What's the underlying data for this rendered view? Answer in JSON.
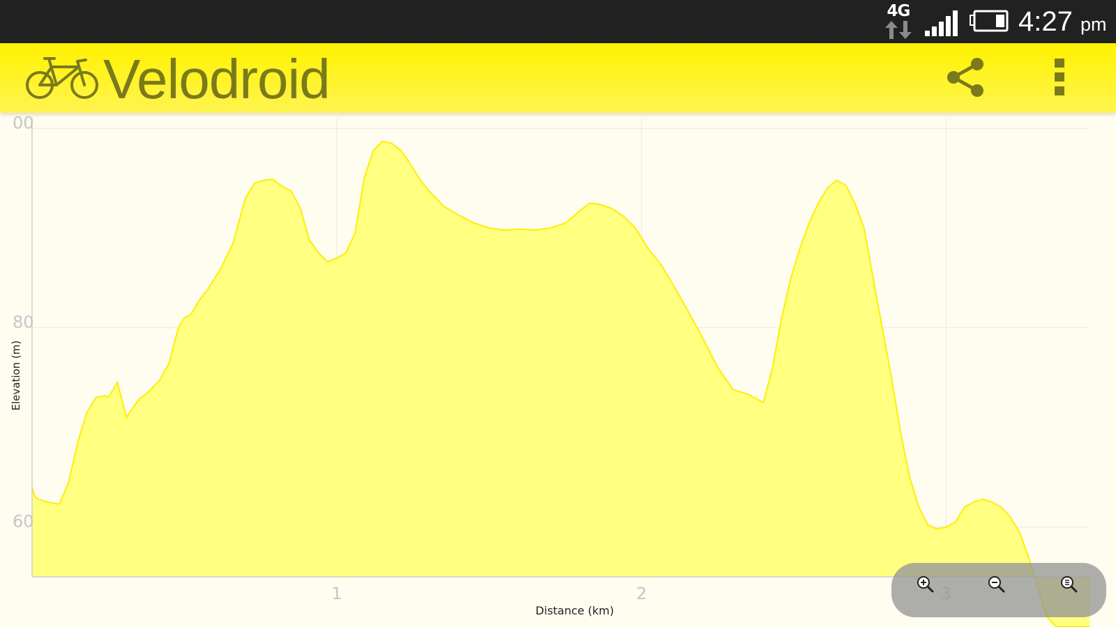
{
  "status_bar": {
    "network_type": "4G",
    "network_arrows_icon": "data-transfer-arrows-icon",
    "signal_icon": "signal-strength-icon",
    "battery_icon": "battery-icon",
    "time": "4:27",
    "ampm": "pm"
  },
  "app_bar": {
    "logo_icon": "bicycle-icon",
    "title": "Velodroid",
    "share_icon": "share-icon",
    "overflow_icon": "overflow-menu-icon",
    "background_color": "#fff200",
    "title_color": "#7a7a1a"
  },
  "zoom_controls": {
    "zoom_in_icon": "zoom-in-icon",
    "zoom_out_icon": "zoom-out-icon",
    "zoom_reset_icon": "zoom-reset-icon"
  },
  "chart_data": {
    "type": "area",
    "xlabel": "Distance (km)",
    "ylabel": "Elevation (m)",
    "xlim": [
      0,
      3.47
    ],
    "ylim": [
      55,
      101
    ],
    "x_ticks": [
      1,
      2,
      3
    ],
    "x_tick_labels": [
      "1",
      "2",
      "3"
    ],
    "y_ticks": [
      60,
      80,
      100
    ],
    "y_tick_labels": [
      "60",
      "80",
      "00"
    ],
    "grid": true,
    "fill_color": "#ffff80",
    "line_color": "#ffee00",
    "series": [
      {
        "x": [
          0.0,
          0.01,
          0.02,
          0.05,
          0.09,
          0.12,
          0.15,
          0.18,
          0.21,
          0.24,
          0.25,
          0.28,
          0.31,
          0.32,
          0.35,
          0.38,
          0.42,
          0.45,
          0.48,
          0.5,
          0.52,
          0.55,
          0.58,
          0.62,
          0.66,
          0.7,
          0.73,
          0.76,
          0.79,
          0.82,
          0.85,
          0.88,
          0.91,
          0.94,
          0.97,
          1.0,
          1.03,
          1.06,
          1.09,
          1.12,
          1.15,
          1.18,
          1.21,
          1.24,
          1.27,
          1.3,
          1.35,
          1.4,
          1.45,
          1.5,
          1.55,
          1.6,
          1.65,
          1.7,
          1.75,
          1.8,
          1.83,
          1.86,
          1.9,
          1.94,
          1.98,
          2.02,
          2.06,
          2.1,
          2.15,
          2.2,
          2.25,
          2.3,
          2.35,
          2.4,
          2.43,
          2.46,
          2.49,
          2.52,
          2.55,
          2.58,
          2.61,
          2.64,
          2.67,
          2.7,
          2.73,
          2.76,
          2.79,
          2.82,
          2.85,
          2.88,
          2.91,
          2.94,
          2.97,
          3.0,
          3.03,
          3.06,
          3.09,
          3.12,
          3.15,
          3.18,
          3.21,
          3.24,
          3.27,
          3.3,
          3.33,
          3.36,
          3.39,
          3.42,
          3.45,
          3.47
        ],
        "y": [
          64.0,
          63.0,
          62.8,
          62.5,
          62.3,
          64.5,
          68.5,
          71.5,
          73.0,
          73.2,
          73.0,
          74.5,
          71.0,
          71.5,
          72.8,
          73.5,
          74.8,
          76.5,
          80.0,
          81.0,
          81.3,
          82.8,
          84.0,
          86.0,
          88.5,
          93.0,
          94.5,
          94.8,
          94.9,
          94.2,
          93.7,
          92.0,
          88.8,
          87.5,
          86.6,
          87.0,
          87.5,
          89.5,
          95.0,
          97.8,
          98.7,
          98.5,
          97.8,
          96.5,
          95.0,
          93.8,
          92.2,
          91.3,
          90.5,
          90.0,
          89.8,
          89.9,
          89.8,
          90.0,
          90.5,
          91.8,
          92.5,
          92.4,
          92.0,
          91.2,
          90.0,
          88.0,
          86.5,
          84.5,
          81.8,
          79.0,
          76.0,
          73.8,
          73.3,
          72.5,
          76.0,
          81.0,
          85.0,
          88.0,
          90.5,
          92.5,
          94.0,
          94.8,
          94.3,
          92.5,
          90.0,
          85.0,
          80.0,
          75.0,
          69.5,
          65.0,
          62.0,
          60.2,
          59.8,
          60.0,
          60.5,
          62.0,
          62.5,
          62.8,
          62.5,
          62.0,
          61.0,
          59.5,
          57.0,
          54.0,
          51.0,
          50.0,
          50.0,
          50.0,
          50.0,
          50.0
        ]
      }
    ]
  }
}
